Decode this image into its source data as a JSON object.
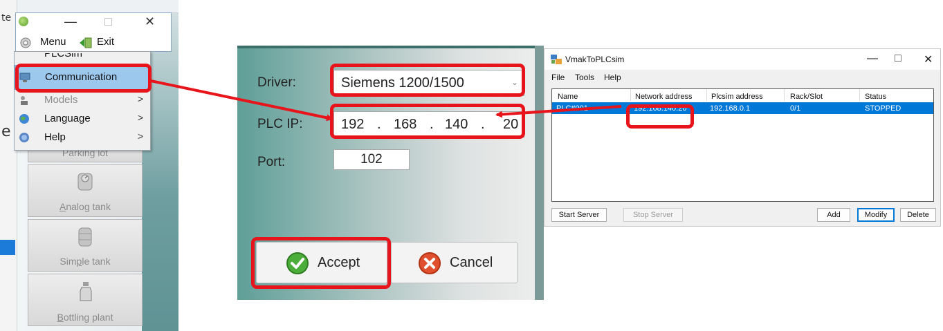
{
  "main_window": {
    "fragment_top": "te",
    "fragment_mid": "e",
    "minimize": "—",
    "maximize": "□",
    "close": "✕",
    "menubar": {
      "menu_label": "Menu",
      "exit_label": "Exit"
    },
    "menu_items": [
      {
        "label": "PLCSim",
        "icon": "plcsim-icon",
        "submenu": false
      },
      {
        "label": "Communication",
        "icon": "network-icon",
        "submenu": false
      },
      {
        "label": "Models",
        "icon": "models-icon",
        "submenu": true
      },
      {
        "label": "Language",
        "icon": "globe-icon",
        "submenu": true
      },
      {
        "label": "Help",
        "icon": "help-icon",
        "submenu": true
      }
    ],
    "tools": [
      {
        "label": "Parking lot",
        "icon": "parking-icon"
      },
      {
        "label": "Analog tank",
        "underline": "A",
        "rest": "nalog tank",
        "icon": "analog-tank-icon"
      },
      {
        "label": "Simple tank",
        "pre": "Sim",
        "underline": "p",
        "rest": "le tank",
        "icon": "simple-tank-icon"
      },
      {
        "label": "Bottling plant",
        "underline": "B",
        "rest": "ottling plant",
        "icon": "bottle-icon"
      }
    ]
  },
  "communication_dialog": {
    "driver_label": "Driver:",
    "driver_value": "Siemens 1200/1500",
    "plc_ip_label": "PLC IP:",
    "ip_octets": [
      "192",
      "168",
      "140",
      "20"
    ],
    "ip_sep": ".",
    "port_label": "Port:",
    "port_value": "102",
    "accept_label": "Accept",
    "cancel_label": "Cancel"
  },
  "plcsim_window": {
    "title": "VmakToPLCsim",
    "minimize": "—",
    "maximize": "□",
    "close": "✕",
    "menu": [
      "File",
      "Tools",
      "Help"
    ],
    "columns": [
      "Name",
      "Network address",
      "Plcsim address",
      "Rack/Slot",
      "Status"
    ],
    "rows": [
      {
        "name": "PLC#001",
        "network_address": "192.168.140.20",
        "plcsim_address": "192.168.0.1",
        "rack_slot": "0/1",
        "status": "STOPPED"
      }
    ],
    "buttons": {
      "start": "Start Server",
      "stop": "Stop Server",
      "add": "Add",
      "modify": "Modify",
      "delete": "Delete"
    }
  },
  "colors": {
    "highlight_red": "#e8141b",
    "selection_blue": "#0078d7",
    "menu_hover": "#9cc8ee"
  }
}
